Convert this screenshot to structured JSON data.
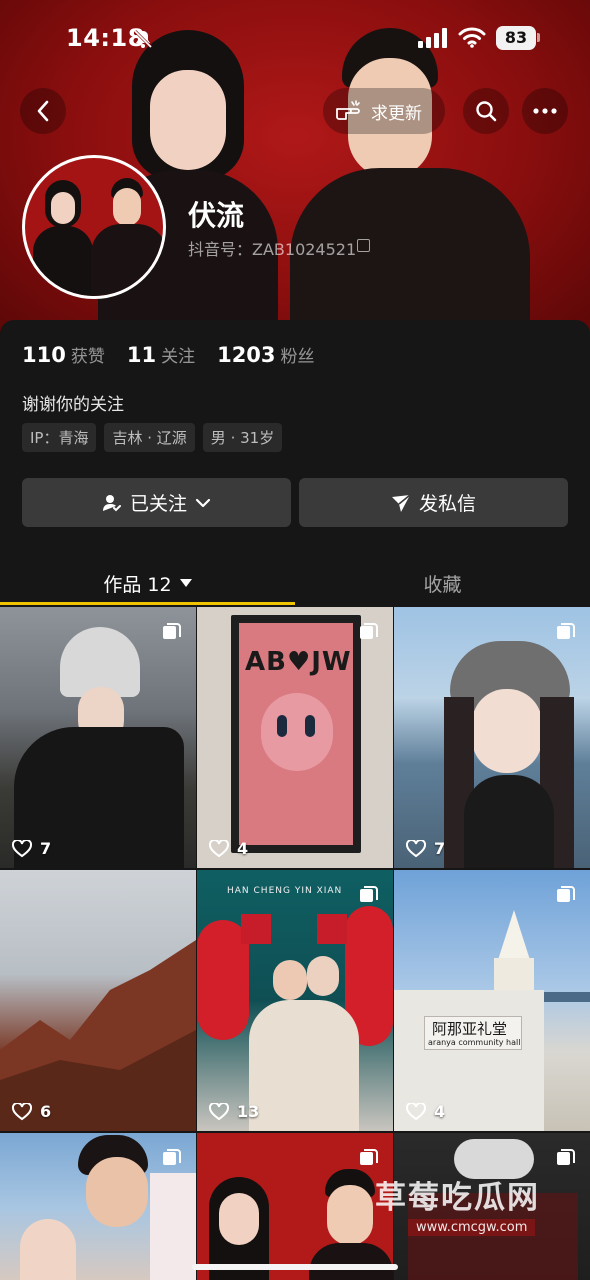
{
  "status_bar": {
    "time": "14:18",
    "battery": "83"
  },
  "header": {
    "update_label": "求更新"
  },
  "profile": {
    "nickname": "伏流",
    "douyin_id": "抖音号：ZAB1024521",
    "stats": [
      {
        "num": "110",
        "label": "获赞"
      },
      {
        "num": "11",
        "label": "关注"
      },
      {
        "num": "1203",
        "label": "粉丝"
      }
    ],
    "bio": "谢谢你的关注",
    "tags": [
      "IP：青海",
      "吉林 · 辽源",
      "男 · 31岁"
    ]
  },
  "actions": {
    "follow_label": "已关注",
    "message_label": "发私信"
  },
  "tabs": {
    "works_label": "作品 12",
    "favorites_label": "收藏"
  },
  "grid": [
    {
      "likes": "7"
    },
    {
      "likes": "4"
    },
    {
      "likes": "7"
    },
    {
      "likes": "6"
    },
    {
      "likes": "13"
    },
    {
      "likes": "4"
    },
    {
      "likes": ""
    },
    {
      "likes": ""
    },
    {
      "likes": ""
    }
  ],
  "photo_text": {
    "poster_letters": "AB♥JW",
    "wedding_banner": "HAN CHENG YIN XIAN",
    "chapel_sign_cn": "阿那亚礼堂",
    "chapel_sign_en": "aranya community hall"
  },
  "watermark": {
    "title": "草莓吃瓜网",
    "url": "www.cmcgw.com"
  },
  "colors": {
    "tab_indicator": "#f0c400",
    "banner_red": "#b01818",
    "panel_bg": "#161616",
    "button_bg": "#3a3a3a"
  }
}
